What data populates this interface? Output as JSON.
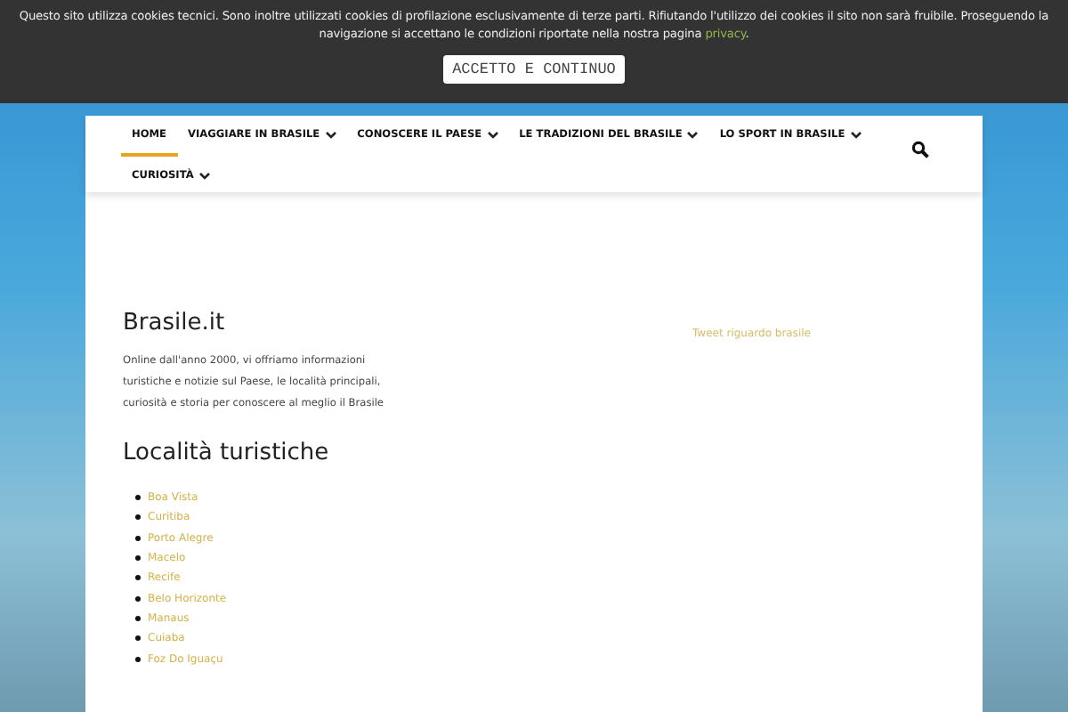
{
  "cookie_banner": {
    "message": "Questo sito utilizza cookies tecnici. Sono inoltre utilizzati cookies di profilazione esclusivamente di terze parti. Rifiutando l'utilizzo dei cookies il sito non sarà fruibile. Proseguendo la navigazione si accettano le condizioni riportate nella nostra pagina ",
    "link": "privacy",
    "message_end": ".",
    "button": "ACCETTO E CONTINUO"
  },
  "nav": {
    "items": [
      {
        "label": "HOME",
        "selected": true,
        "dropdown": false
      },
      {
        "label": "VIAGGIARE IN BRASILE",
        "selected": false,
        "dropdown": true
      },
      {
        "label": "CONOSCERE IL PAESE",
        "selected": false,
        "dropdown": true
      },
      {
        "label": "LE TRADIZIONI DEL BRASILE",
        "selected": false,
        "dropdown": true
      },
      {
        "label": "LO SPORT IN BRASILE",
        "selected": false,
        "dropdown": true
      },
      {
        "label": "CURIOSITÀ",
        "selected": false,
        "dropdown": true
      }
    ]
  },
  "about": {
    "title": "Brasile.it",
    "text": "Online dall'anno 2000, vi offriamo informazioni turistiche e notizie sul Paese, le località principali, curiosità e storia per conoscere al meglio il Brasile"
  },
  "places": {
    "title": "Località turistiche",
    "items": [
      "Boa Vista",
      "Curitiba",
      "Porto Alegre",
      "Macelo",
      "Recife",
      "Belo Horizonte",
      "Manaus",
      "Cuiaba",
      "Foz Do Iguaçu"
    ]
  },
  "tweets": {
    "link": "Tweet riguardo brasile"
  }
}
